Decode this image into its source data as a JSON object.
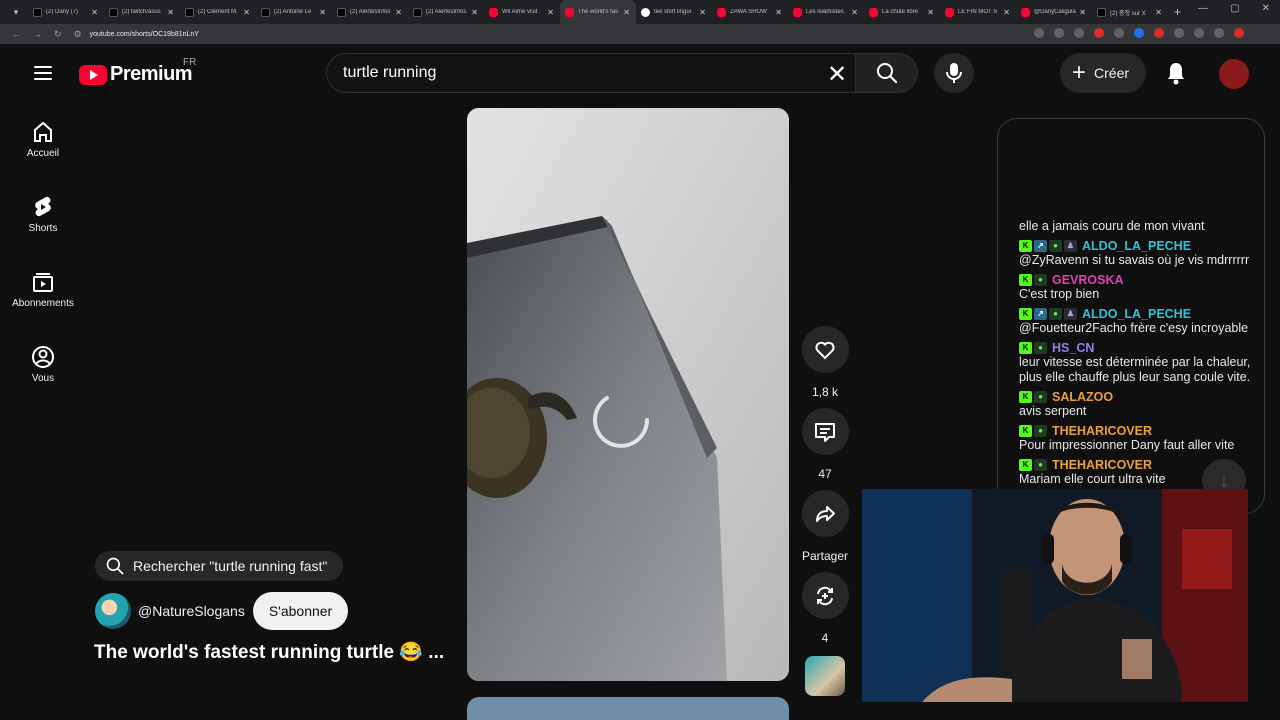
{
  "browser": {
    "tabs": [
      {
        "title": "(2) Dany (7)",
        "favicon": "x"
      },
      {
        "title": "(2) twitch/asus",
        "favicon": "x"
      },
      {
        "title": "(2) Clément M.",
        "favicon": "x"
      },
      {
        "title": "(2) Antoine Le",
        "favicon": "x"
      },
      {
        "title": "(2) AlertesInfos",
        "favicon": "x"
      },
      {
        "title": "(2) AlertesInfos",
        "favicon": "x"
      },
      {
        "title": "Wil Aime visit",
        "favicon": "yt"
      },
      {
        "title": "The world's fas",
        "favicon": "yt",
        "active": true
      },
      {
        "title": "tee shirt lingui",
        "favicon": "g"
      },
      {
        "title": "ZAWA SHOW",
        "favicon": "yt"
      },
      {
        "title": "Les islamistes",
        "favicon": "yt"
      },
      {
        "title": "La chute libre",
        "favicon": "yt"
      },
      {
        "title": "LE FIN MOT S",
        "favicon": "yt"
      },
      {
        "title": "@DanyCaligula",
        "favicon": "yt"
      },
      {
        "title": "(2) 충청 sur X",
        "favicon": "x"
      }
    ],
    "url": "youtube.com/shorts/OC19b81nLnY"
  },
  "header": {
    "logo_text": "Premium",
    "country_code": "FR",
    "search_value": "turtle running",
    "create_label": "Créer"
  },
  "sidebar": {
    "items": [
      {
        "label": "Accueil",
        "icon": "home-icon"
      },
      {
        "label": "Shorts",
        "icon": "shorts-icon"
      },
      {
        "label": "Abonnements",
        "icon": "subscriptions-icon"
      },
      {
        "label": "Vous",
        "icon": "you-icon"
      }
    ]
  },
  "short": {
    "suggest_label": "Rechercher \"turtle running fast\"",
    "channel": "@NatureSlogans",
    "subscribe_label": "S'abonner",
    "title": "The world's fastest running turtle 😂 ...",
    "likes": "1,8 k",
    "comments": "47",
    "share_label": "Partager",
    "remix_count": "4"
  },
  "chat": {
    "partial_text": "elle a jamais couru de mon vivant",
    "messages": [
      {
        "user": "ALDO_LA_PECHE",
        "color": "#2ec4d6",
        "badges": [
          "k",
          "a",
          "g",
          "s"
        ],
        "text": "@ZyRavenn si tu savais où je vis mdrrrrrr"
      },
      {
        "user": "GEVROSKA",
        "color": "#e040b0",
        "badges": [
          "k",
          "g"
        ],
        "text": "C'est trop bien"
      },
      {
        "user": "ALDO_LA_PECHE",
        "color": "#2ec4d6",
        "badges": [
          "k",
          "a",
          "g",
          "s"
        ],
        "text": "@Fouetteur2Facho frère c'esy incroyable"
      },
      {
        "user": "HS_CN",
        "color": "#9b7cf0",
        "badges": [
          "k",
          "g"
        ],
        "text": "leur vitesse est déterminée par la chaleur, plus elle chauffe plus leur sang coule vite."
      },
      {
        "user": "SALAZOO",
        "color": "#e8a23a",
        "badges": [
          "k",
          "g"
        ],
        "text": "avis serpent"
      },
      {
        "user": "THEHARICOVER",
        "color": "#e8a23a",
        "badges": [
          "k",
          "g"
        ],
        "text": "Pour impressionner Dany faut aller vite"
      },
      {
        "user": "THEHARICOVER",
        "color": "#e8a23a",
        "badges": [
          "k",
          "g"
        ],
        "text": "Mariam elle court ultra vite"
      }
    ]
  }
}
